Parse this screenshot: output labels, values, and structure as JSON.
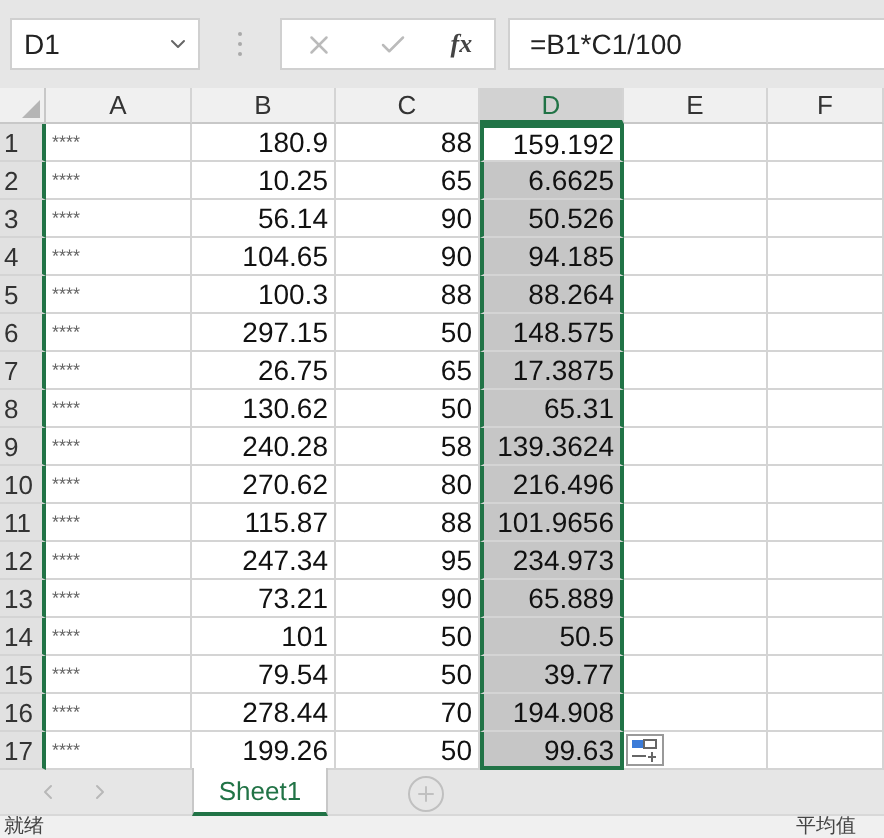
{
  "formula_bar": {
    "name_box": "D1",
    "function_label": "fx",
    "formula": "=B1*C1/100"
  },
  "columns": [
    {
      "label": "A",
      "selected": false
    },
    {
      "label": "B",
      "selected": false
    },
    {
      "label": "C",
      "selected": false
    },
    {
      "label": "D",
      "selected": true
    },
    {
      "label": "E",
      "selected": false
    },
    {
      "label": "F",
      "selected": false
    }
  ],
  "rows": [
    {
      "number": "1",
      "cells": [
        "****",
        "180.9",
        "88",
        "159.192"
      ],
      "selected": true,
      "active": true
    },
    {
      "number": "2",
      "cells": [
        "****",
        "10.25",
        "65",
        "6.6625"
      ],
      "selected": true,
      "active": false
    },
    {
      "number": "3",
      "cells": [
        "****",
        "56.14",
        "90",
        "50.526"
      ],
      "selected": true,
      "active": false
    },
    {
      "number": "4",
      "cells": [
        "****",
        "104.65",
        "90",
        "94.185"
      ],
      "selected": true,
      "active": false
    },
    {
      "number": "5",
      "cells": [
        "****",
        "100.3",
        "88",
        "88.264"
      ],
      "selected": true,
      "active": false
    },
    {
      "number": "6",
      "cells": [
        "****",
        "297.15",
        "50",
        "148.575"
      ],
      "selected": true,
      "active": false
    },
    {
      "number": "7",
      "cells": [
        "****",
        "26.75",
        "65",
        "17.3875"
      ],
      "selected": true,
      "active": false
    },
    {
      "number": "8",
      "cells": [
        "****",
        "130.62",
        "50",
        "65.31"
      ],
      "selected": true,
      "active": false
    },
    {
      "number": "9",
      "cells": [
        "****",
        "240.28",
        "58",
        "139.3624"
      ],
      "selected": true,
      "active": false
    },
    {
      "number": "10",
      "cells": [
        "****",
        "270.62",
        "80",
        "216.496"
      ],
      "selected": true,
      "active": false
    },
    {
      "number": "11",
      "cells": [
        "****",
        "115.87",
        "88",
        "101.9656"
      ],
      "selected": true,
      "active": false
    },
    {
      "number": "12",
      "cells": [
        "****",
        "247.34",
        "95",
        "234.973"
      ],
      "selected": true,
      "active": false
    },
    {
      "number": "13",
      "cells": [
        "****",
        "73.21",
        "90",
        "65.889"
      ],
      "selected": true,
      "active": false
    },
    {
      "number": "14",
      "cells": [
        "****",
        "101",
        "50",
        "50.5"
      ],
      "selected": true,
      "active": false
    },
    {
      "number": "15",
      "cells": [
        "****",
        "79.54",
        "50",
        "39.77"
      ],
      "selected": true,
      "active": false
    },
    {
      "number": "16",
      "cells": [
        "****",
        "278.44",
        "70",
        "194.908"
      ],
      "selected": true,
      "active": false
    },
    {
      "number": "17",
      "cells": [
        "****",
        "199.26",
        "50",
        "99.63"
      ],
      "selected": true,
      "active": false
    }
  ],
  "sheet_tabs": [
    {
      "label": "Sheet1",
      "selected": true
    }
  ],
  "status_bar": {
    "left": "就绪",
    "right": "平均值"
  }
}
